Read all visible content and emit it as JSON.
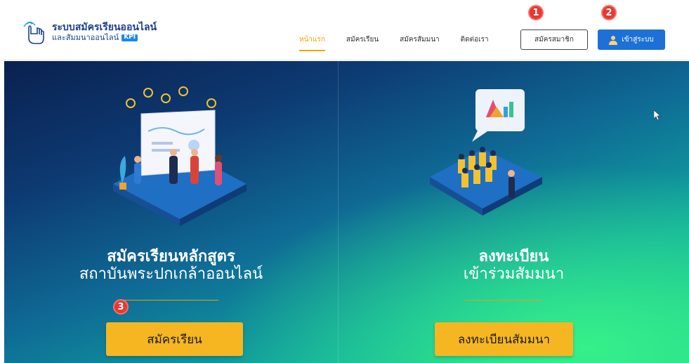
{
  "header": {
    "logo": {
      "title": "ระบบสมัครเรียนออนไลน์",
      "subtitle": "และสัมมนาออนไลน์",
      "badge": "KPI",
      "icon": "hand-pointer-icon"
    },
    "nav": {
      "items": [
        {
          "label": "หน้าแรก",
          "active": true
        },
        {
          "label": "สมัครเรียน",
          "active": false
        },
        {
          "label": "สมัครสัมมนา",
          "active": false
        },
        {
          "label": "ติดต่อเรา",
          "active": false
        }
      ]
    },
    "register_button": "สมัครสมาชิก",
    "login_button": "เข้าสู่ระบบ",
    "login_icon": "user-icon"
  },
  "markers": {
    "m1": "1",
    "m2": "2",
    "m3": "3"
  },
  "hero": {
    "left": {
      "title_line1": "สมัครเรียนหลักสูตร",
      "title_line2": "สถาบันพระปกเกล้าออนไลน์",
      "cta": "สมัครเรียน"
    },
    "right": {
      "title_line1": "ลงทะเบียน",
      "title_line2": "เข้าร่วมสัมมนา",
      "cta": "ลงทะเบียนสัมมนา"
    }
  },
  "colors": {
    "brand_blue": "#1b3f8f",
    "accent_orange": "#f0a400",
    "login_blue": "#1d71d6",
    "cta_yellow": "#f5b622",
    "marker_red": "#e53935"
  }
}
